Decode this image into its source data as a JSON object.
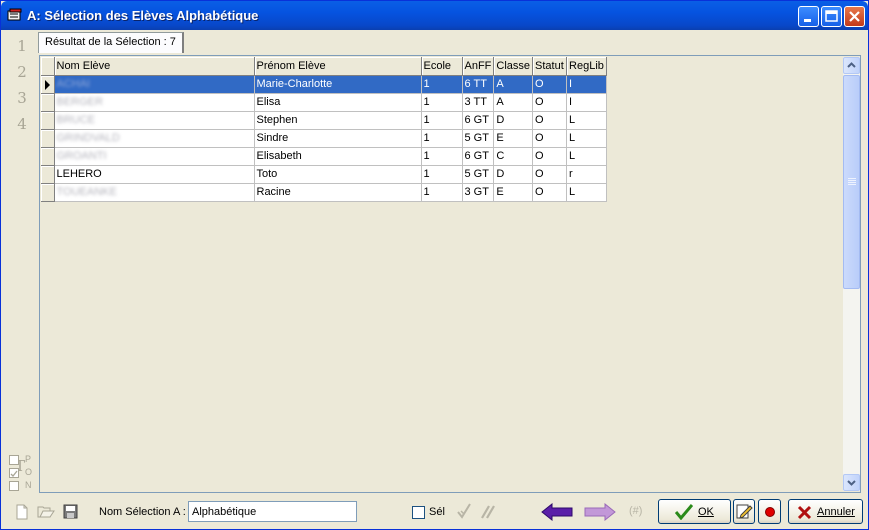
{
  "window": {
    "title": "A: Sélection des Elèves Alphabétique"
  },
  "left_tabs": [
    "1",
    "2",
    "3",
    "4"
  ],
  "left_tools": {
    "t_glyph": "T",
    "letters": [
      "P",
      "O",
      "N"
    ]
  },
  "tab": {
    "label": "Résultat de la Sélection : 7"
  },
  "grid": {
    "columns": [
      "Nom Elève",
      "Prénom Elève",
      "Ecole",
      "AnFF",
      "Classe",
      "Statut",
      "RegLib"
    ],
    "rows": [
      {
        "nom": "ACHAI",
        "prenom": "Marie-Charlotte",
        "ecole": "1",
        "anff": "6 TT",
        "classe": "A",
        "statut": "O",
        "reglib": "I",
        "nom_blurred": true
      },
      {
        "nom": "BERGER",
        "prenom": "Elisa",
        "ecole": "1",
        "anff": "3 TT",
        "classe": "A",
        "statut": "O",
        "reglib": "I",
        "nom_blurred": true
      },
      {
        "nom": "BRUCE",
        "prenom": "Stephen",
        "ecole": "1",
        "anff": "6 GT",
        "classe": "D",
        "statut": "O",
        "reglib": "L",
        "nom_blurred": true
      },
      {
        "nom": "GRINDVALD",
        "prenom": "Sindre",
        "ecole": "1",
        "anff": "5 GT",
        "classe": "E",
        "statut": "O",
        "reglib": "L",
        "nom_blurred": true
      },
      {
        "nom": "GROANTI",
        "prenom": "Elisabeth",
        "ecole": "1",
        "anff": "6 GT",
        "classe": "C",
        "statut": "O",
        "reglib": "L",
        "nom_blurred": true
      },
      {
        "nom": "LEHERO",
        "prenom": "Toto",
        "ecole": "1",
        "anff": "5 GT",
        "classe": "D",
        "statut": "O",
        "reglib": "r",
        "nom_blurred": false
      },
      {
        "nom": "TOUEANKE",
        "prenom": "Racine",
        "ecole": "1",
        "anff": "3 GT",
        "classe": "E",
        "statut": "O",
        "reglib": "L",
        "nom_blurred": true
      }
    ],
    "selected_row": 0
  },
  "bottom": {
    "nom_selection_label": "Nom Sélection A :",
    "nom_selection_value": "Alphabétique",
    "sel_label": "Sél",
    "hash_label": "(#)",
    "ok_label": "OK",
    "annuler_label": "Annuler"
  },
  "colors": {
    "titlebar": "#0553e0",
    "selection": "#316ac5",
    "arrow": "#5a1fa8",
    "ok_check": "#2a8a1a",
    "annuler_x": "#b01010"
  }
}
